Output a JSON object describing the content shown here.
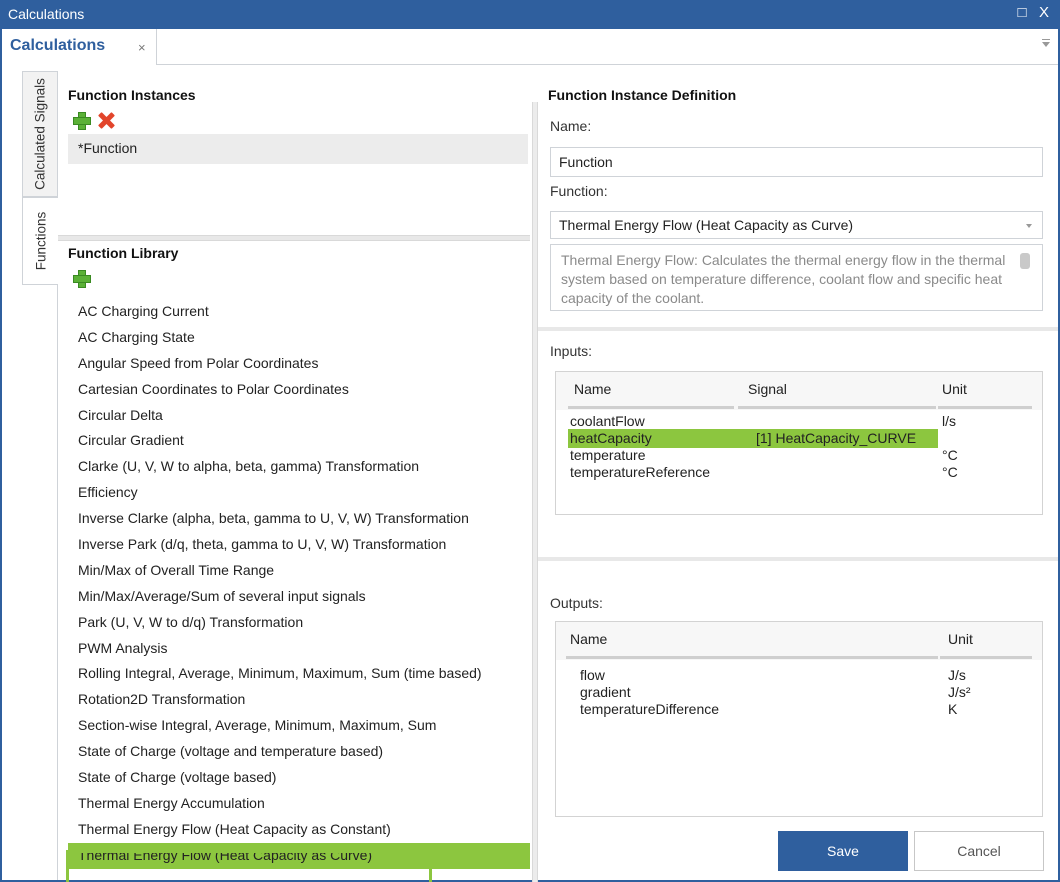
{
  "window": {
    "title": "Calculations",
    "buttons": {
      "restore": "□",
      "close": "X"
    }
  },
  "doc_tab": {
    "label": "Calculations",
    "close": "×"
  },
  "side_tabs": {
    "calculated_signals": "Calculated Signals",
    "functions": "Functions"
  },
  "instances": {
    "title": "Function Instances",
    "items": [
      "*Function"
    ]
  },
  "library": {
    "title": "Function Library",
    "items": [
      "AC Charging Current",
      "AC Charging State",
      "Angular Speed from Polar Coordinates",
      "Cartesian Coordinates to Polar Coordinates",
      "Circular Delta",
      "Circular Gradient",
      "Clarke (U, V, W to alpha, beta, gamma) Transformation",
      "Efficiency",
      "Inverse Clarke (alpha, beta, gamma to U, V, W) Transformation",
      "Inverse Park (d/q, theta, gamma to U, V, W) Transformation",
      "Min/Max of Overall Time Range",
      "Min/Max/Average/Sum of several input signals",
      "Park (U, V, W to d/q) Transformation",
      "PWM Analysis",
      "Rolling Integral, Average, Minimum, Maximum, Sum (time based)",
      "Rotation2D Transformation",
      "Section-wise Integral, Average, Minimum, Maximum, Sum",
      "State of Charge (voltage and temperature based)",
      "State of Charge (voltage based)",
      "Thermal Energy Accumulation",
      "Thermal Energy Flow (Heat Capacity as Constant)",
      "Thermal Energy Flow (Heat Capacity as Curve)"
    ],
    "selected_index": 21,
    "highlight_color": "#8cc63f"
  },
  "definition": {
    "title": "Function Instance Definition",
    "name_label": "Name:",
    "name_value": "Function",
    "function_label": "Function:",
    "function_value": "Thermal Energy Flow (Heat Capacity as Curve)",
    "description": "Thermal Energy Flow: Calculates the thermal energy flow in the thermal system based on temperature difference, coolant flow and specific heat capacity of the coolant."
  },
  "inputs": {
    "label": "Inputs:",
    "headers": {
      "name": "Name",
      "signal": "Signal",
      "unit": "Unit"
    },
    "rows": [
      {
        "name": "coolantFlow",
        "signal": "",
        "unit": "l/s"
      },
      {
        "name": "heatCapacity",
        "signal": "[1] HeatCapacity_CURVE",
        "unit": ""
      },
      {
        "name": "temperature",
        "signal": "",
        "unit": "°C"
      },
      {
        "name": "temperatureReference",
        "signal": "",
        "unit": "°C"
      }
    ]
  },
  "outputs": {
    "label": "Outputs:",
    "headers": {
      "name": "Name",
      "unit": "Unit"
    },
    "rows": [
      {
        "name": "flow",
        "unit": "J/s"
      },
      {
        "name": "gradient",
        "unit": "J/s²"
      },
      {
        "name": "temperatureDifference",
        "unit": "K"
      }
    ]
  },
  "actions": {
    "save": "Save",
    "cancel": "Cancel"
  },
  "colors": {
    "accent": "#2f5f9e",
    "highlight": "#8cc63f"
  }
}
